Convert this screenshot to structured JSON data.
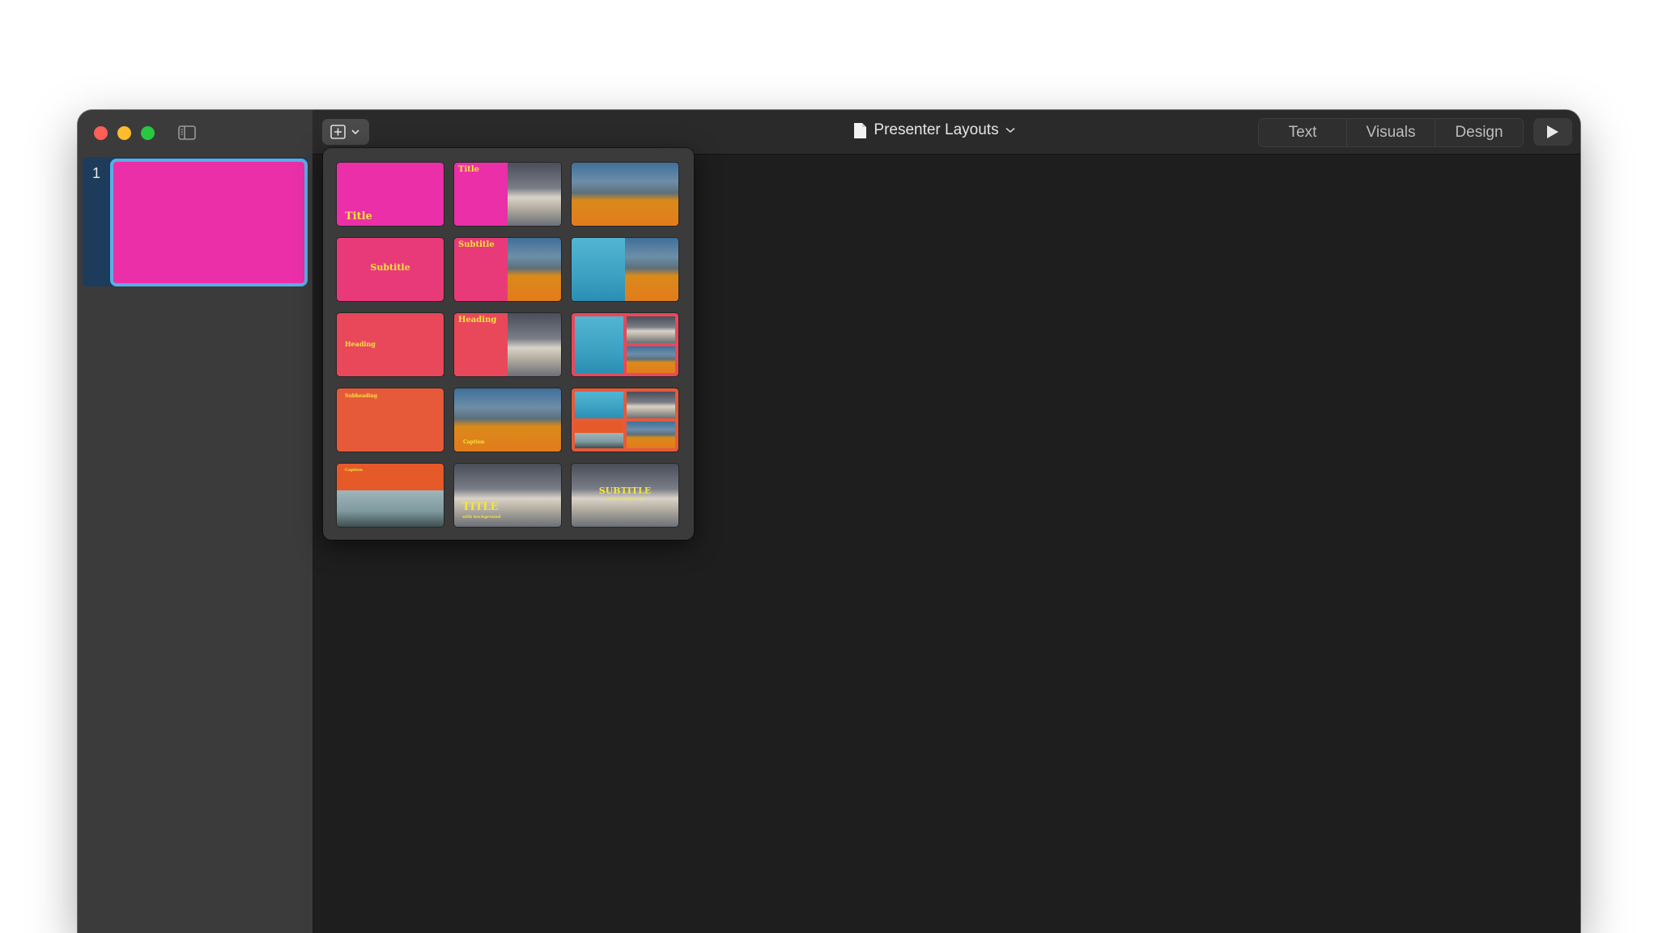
{
  "window": {
    "document_title": "Presenter Layouts",
    "modes": [
      "Text",
      "Visuals",
      "Design"
    ],
    "icons": {
      "sidebar_toggle": "sidebar-toggle-icon",
      "add_slide": "add-slide-icon",
      "chevron": "chevron-down-icon",
      "document": "document-icon",
      "play": "play-icon"
    }
  },
  "sidebar": {
    "slides": [
      {
        "number": "1",
        "color": "#ea2fa8"
      }
    ]
  },
  "layout_popover": {
    "layouts": [
      {
        "id": "title",
        "label": "Title"
      },
      {
        "id": "title-photo",
        "label": "Title"
      },
      {
        "id": "photo",
        "label": ""
      },
      {
        "id": "subtitle",
        "label": "Subtitle"
      },
      {
        "id": "subtitle-photo",
        "label": "Subtitle"
      },
      {
        "id": "two-photos",
        "label": ""
      },
      {
        "id": "heading",
        "label": "Heading"
      },
      {
        "id": "heading-photo",
        "label": "Heading"
      },
      {
        "id": "three-photos",
        "label": ""
      },
      {
        "id": "subheading",
        "label": "Subheading"
      },
      {
        "id": "caption-photo",
        "label": "Caption"
      },
      {
        "id": "four-photos",
        "label": ""
      },
      {
        "id": "caption-skate",
        "label": "Caption"
      },
      {
        "id": "title-background",
        "label": "TITLE",
        "sublabel": "with background"
      },
      {
        "id": "subtitle-background",
        "label": "SUBTITLE",
        "sublabel": "with background"
      }
    ],
    "colors": {
      "magenta": "#ea2fa8",
      "pink": "#e83a78",
      "coral": "#e8485a",
      "orange": "#e65a3a",
      "label_yellow": "#f5e63a"
    }
  }
}
